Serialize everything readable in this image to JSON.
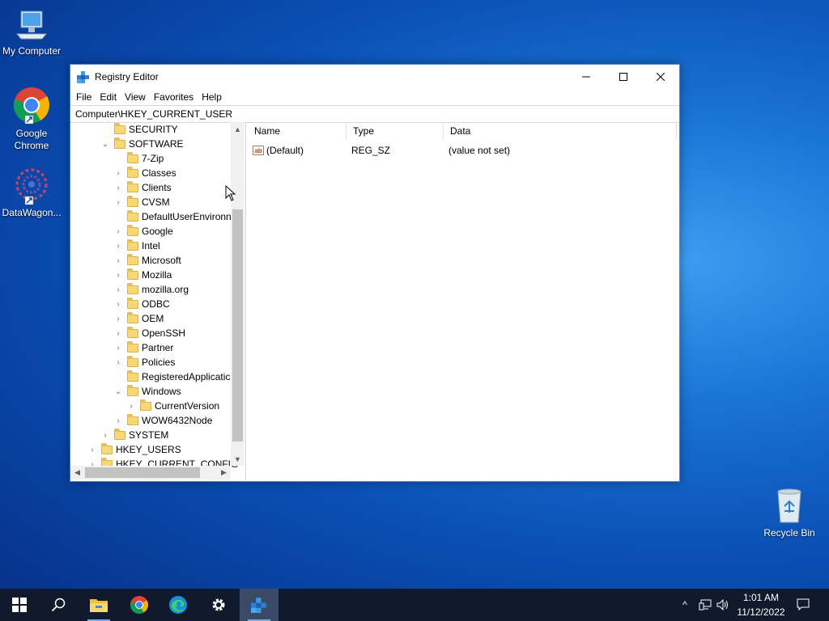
{
  "desktop": {
    "icons": [
      {
        "label": "My Computer"
      },
      {
        "label": "Google Chrome"
      },
      {
        "label": "DataWagon..."
      },
      {
        "label": "Recycle Bin"
      }
    ]
  },
  "window": {
    "title": "Registry Editor",
    "controls": {
      "minimize": "—",
      "maximize": "☐",
      "close": "✕"
    },
    "menu": [
      "File",
      "Edit",
      "View",
      "Favorites",
      "Help"
    ],
    "address": "Computer\\HKEY_CURRENT_USER",
    "tree": [
      {
        "label": "SECURITY",
        "chevron": ""
      },
      {
        "label": "SOFTWARE",
        "chevron": "⌄"
      },
      {
        "label": "7-Zip",
        "chevron": ""
      },
      {
        "label": "Classes",
        "chevron": "›"
      },
      {
        "label": "Clients",
        "chevron": "›"
      },
      {
        "label": "CVSM",
        "chevron": "›"
      },
      {
        "label": "DefaultUserEnvironn",
        "chevron": ""
      },
      {
        "label": "Google",
        "chevron": "›"
      },
      {
        "label": "Intel",
        "chevron": "›"
      },
      {
        "label": "Microsoft",
        "chevron": "›"
      },
      {
        "label": "Mozilla",
        "chevron": "›"
      },
      {
        "label": "mozilla.org",
        "chevron": "›"
      },
      {
        "label": "ODBC",
        "chevron": "›"
      },
      {
        "label": "OEM",
        "chevron": "›"
      },
      {
        "label": "OpenSSH",
        "chevron": "›"
      },
      {
        "label": "Partner",
        "chevron": "›"
      },
      {
        "label": "Policies",
        "chevron": "›"
      },
      {
        "label": "RegisteredApplicatic",
        "chevron": ""
      },
      {
        "label": "Windows",
        "chevron": "⌄"
      },
      {
        "label": "CurrentVersion",
        "chevron": "›"
      },
      {
        "label": "WOW6432Node",
        "chevron": "›"
      },
      {
        "label": "SYSTEM",
        "chevron": "›"
      },
      {
        "label": "HKEY_USERS",
        "chevron": "›"
      },
      {
        "label": "HKEY_CURRENT_CONFIG",
        "chevron": "›"
      }
    ],
    "columns": [
      "Name",
      "Type",
      "Data"
    ],
    "values": [
      {
        "name": "(Default)",
        "type": "REG_SZ",
        "data": "(value not set)",
        "icon": "ab"
      }
    ]
  },
  "taskbar": {
    "apps": [
      "start-icon",
      "search-icon",
      "file-explorer-icon",
      "chrome-icon",
      "edge-icon",
      "settings-icon",
      "regedit-icon"
    ],
    "tray": {
      "chevron": "^"
    },
    "clock": {
      "time": "1:01 AM",
      "date": "11/12/2022"
    }
  },
  "colors": {
    "accent": "#0078d7",
    "taskbar": "#101a2c",
    "folder": "#f8d775"
  }
}
